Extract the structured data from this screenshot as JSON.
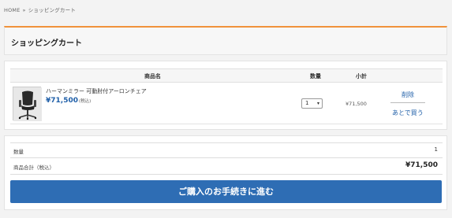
{
  "breadcrumb": {
    "home": "HOME",
    "separator": "»",
    "current": "ショッピングカート"
  },
  "page_title": "ショッピングカート",
  "cart_table": {
    "headers": {
      "product": "商品名",
      "quantity": "数量",
      "subtotal": "小計"
    },
    "items": [
      {
        "name": "ハーマンミラー 可動肘付アーロンチェア",
        "price": "¥71,500",
        "tax_note": "(税込)",
        "quantity": "1",
        "subtotal": "¥71,500",
        "delete_label": "削除",
        "save_later_label": "あとで買う"
      }
    ]
  },
  "summary": {
    "qty_label": "数量",
    "qty_value": "1",
    "total_label": "商品合計（税込）",
    "total_value": "¥71,500"
  },
  "checkout_label": "ご購入のお手続きに進む",
  "colors": {
    "accent": "#f0923a",
    "primary": "#2e6db4",
    "price": "#1f5fa8"
  }
}
